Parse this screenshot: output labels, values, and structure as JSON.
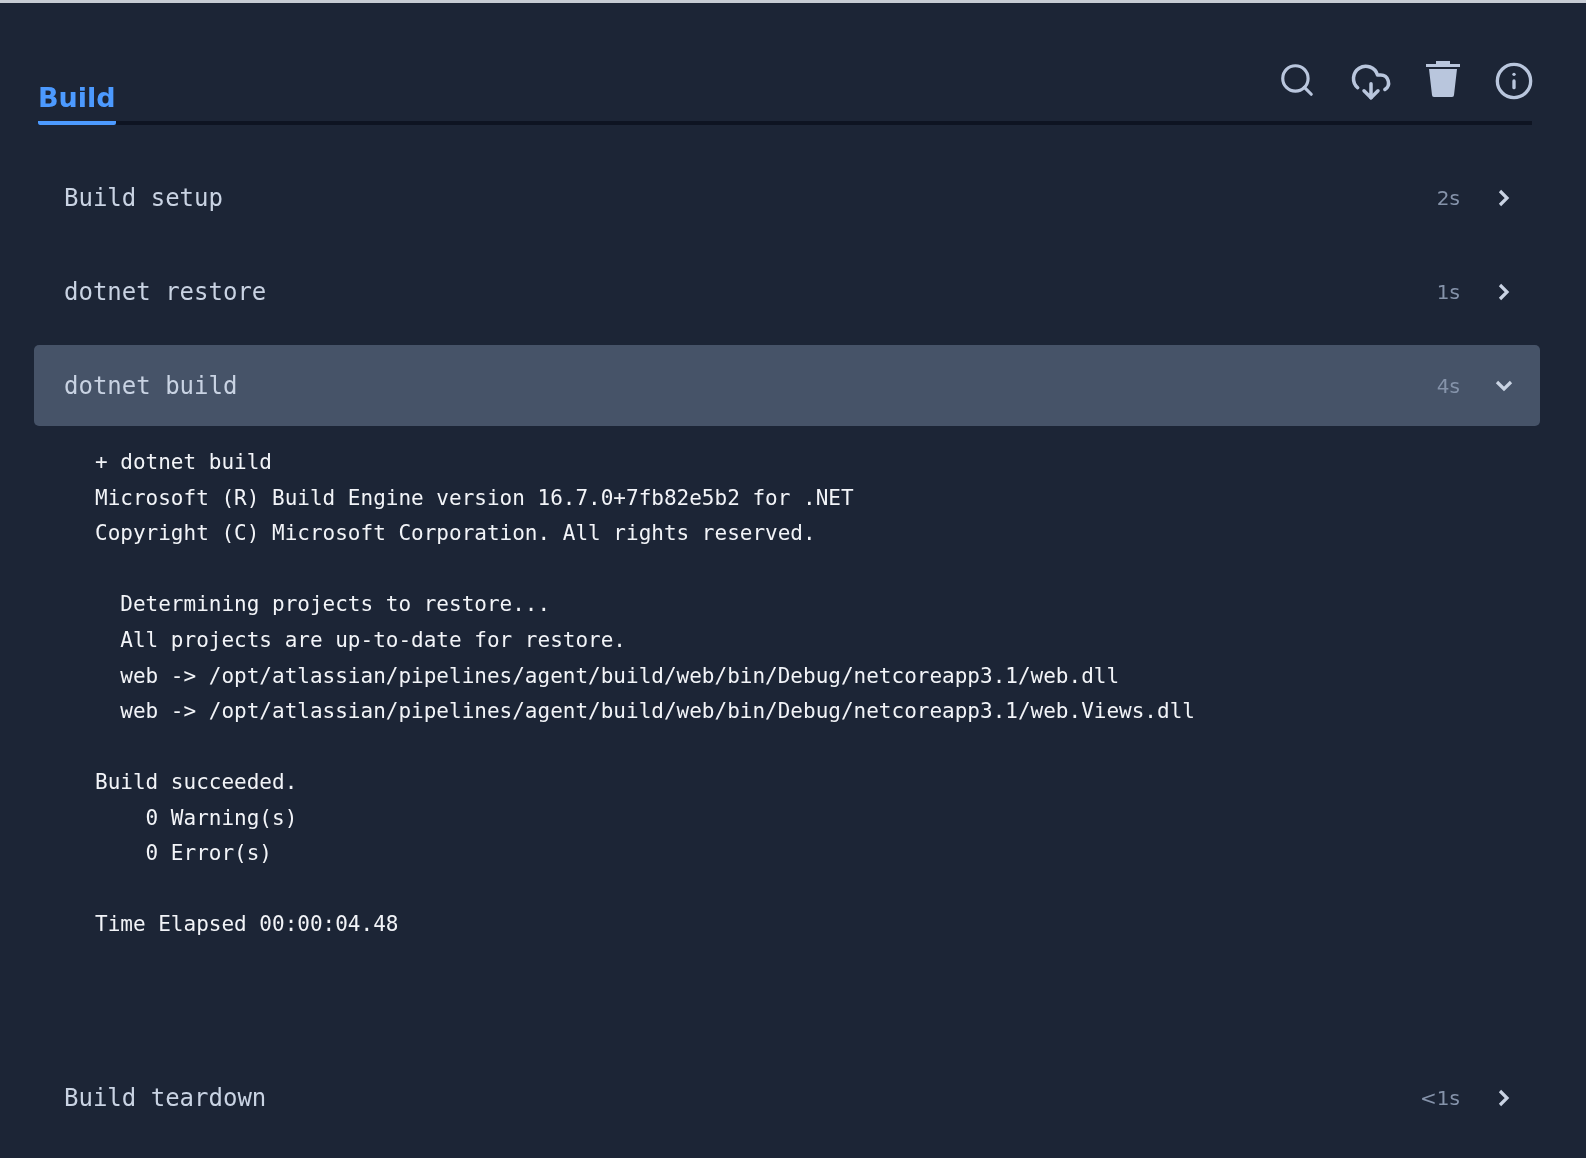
{
  "tabs": [
    {
      "label": "Build",
      "selected": true
    }
  ],
  "toolbar": [
    {
      "kind": "search"
    },
    {
      "kind": "download"
    },
    {
      "kind": "delete"
    },
    {
      "kind": "info"
    }
  ],
  "steps": [
    {
      "name": "Build setup",
      "duration": "2s",
      "expanded": false
    },
    {
      "name": "dotnet restore",
      "duration": "1s",
      "expanded": false
    },
    {
      "name": "dotnet build",
      "duration": "4s",
      "expanded": true,
      "log": [
        [
          "+ dotnet build",
          "Microsoft (R) Build Engine version 16.7.0+7fb82e5b2 for .NET",
          "Copyright (C) Microsoft Corporation. All rights reserved."
        ],
        [
          "  Determining projects to restore...",
          "  All projects are up-to-date for restore.",
          "  web -> /opt/atlassian/pipelines/agent/build/web/bin/Debug/netcoreapp3.1/web.dll",
          "  web -> /opt/atlassian/pipelines/agent/build/web/bin/Debug/netcoreapp3.1/web.Views.dll"
        ],
        [
          "Build succeeded.",
          "    0 Warning(s)",
          "    0 Error(s)"
        ],
        [
          "Time Elapsed 00:00:04.48"
        ]
      ]
    },
    {
      "name": "Build teardown",
      "duration": "<1s",
      "expanded": false
    }
  ]
}
